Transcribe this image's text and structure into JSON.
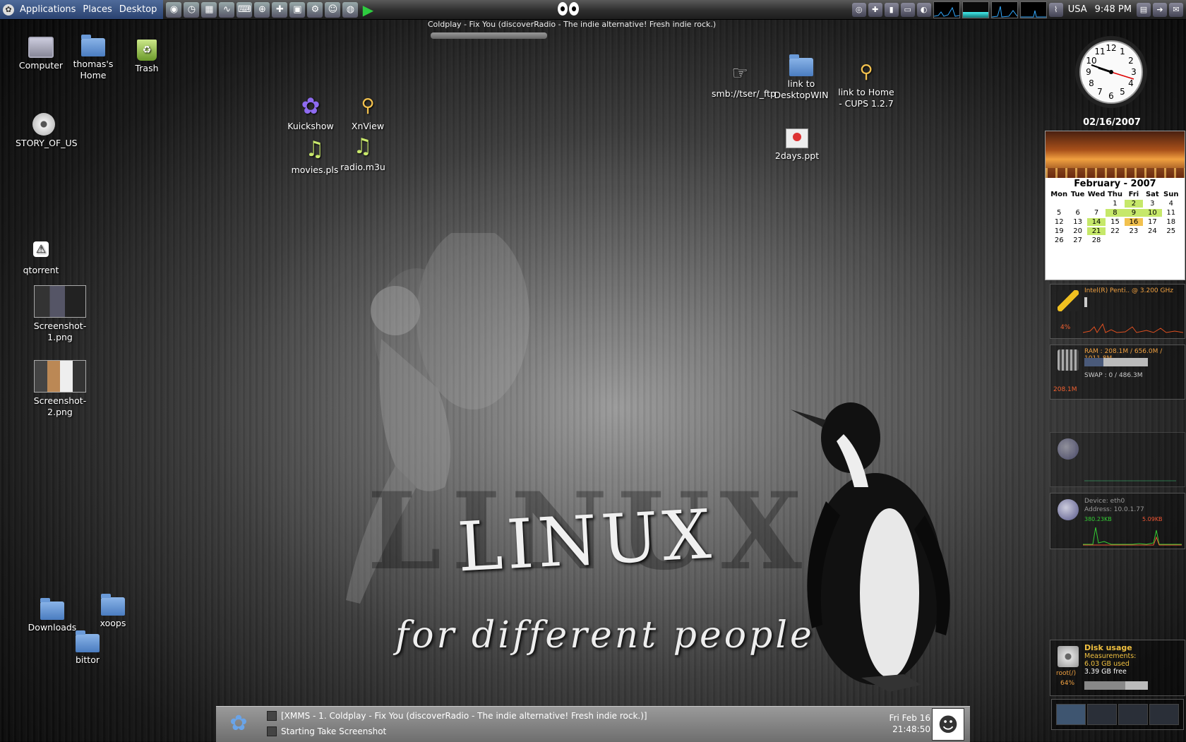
{
  "top_panel": {
    "menus": [
      "Applications",
      "Places",
      "Desktop"
    ],
    "tray_locale": "USA",
    "tray_time": "9:48 PM"
  },
  "xmms": {
    "now_playing": "Coldplay - Fix You (discoverRadio - The indie alternative! Fresh indie rock.)"
  },
  "desktop_icons": {
    "computer": "Computer",
    "home": "thomas's Home",
    "trash": "Trash",
    "story": "STORY_OF_US",
    "qtorrent": "qtorrent",
    "screenshot1": "Screenshot-1.png",
    "screenshot2": "Screenshot-2.png",
    "downloads": "Downloads",
    "xoops": "xoops",
    "bittor": "bittor",
    "kuickshow": "Kuickshow",
    "xnview": "XnView",
    "movies": "movies.pls",
    "radio": "radio.m3u",
    "smb": "smb://tser/_ftp",
    "link_win": "link to DesktopWIN",
    "link_cups": "link to Home - CUPS 1.2.7",
    "ppt": "2days.ppt"
  },
  "wallpaper": {
    "title": "LINUX",
    "shadow": "LINUX",
    "tagline": "for different people"
  },
  "clock": {
    "date": "02/16/2007"
  },
  "calendar": {
    "month": "February - 2007",
    "weekdays": [
      "Mon",
      "Tue",
      "Wed",
      "Thu",
      "Fri",
      "Sat",
      "Sun"
    ],
    "days": [
      "",
      "",
      "",
      "1",
      "2",
      "3",
      "4",
      "5",
      "6",
      "7",
      "8",
      "9",
      "10",
      "11",
      "12",
      "13",
      "14",
      "15",
      "16",
      "17",
      "18",
      "19",
      "20",
      "21",
      "22",
      "23",
      "24",
      "25",
      "26",
      "27",
      "28",
      "",
      "",
      "",
      ""
    ],
    "highlighted": [
      2,
      8,
      9,
      10,
      14,
      21
    ],
    "today": 16
  },
  "monitors": {
    "cpu_label": "Intel(R) Penti.. @ 3.200 GHz",
    "cpu_pct": "4%",
    "ram_label": "RAM : 208.1M / 656.0M / 1011.8M",
    "swap_label": "SWAP : 0 / 486.3M",
    "ram_used": "208.1M",
    "net_device": "Device: eth0",
    "net_address": "Address: 10.0.1.77",
    "net_rate_down": "380.23KB",
    "net_rate_up": "5.09KB",
    "disk_title": "Disk usage",
    "disk_measure": "Measurements:",
    "disk_used": "6.03 GB used",
    "disk_free": "3.39 GB free",
    "disk_root": "root(/)",
    "disk_pct": "64%",
    "disk_fraction": 0.64
  },
  "bottom_panel": {
    "task1": "[XMMS - 1. Coldplay - Fix You (discoverRadio - The indie alternative! Fresh indie rock.)]",
    "task2": "Starting Take Screenshot",
    "date": "Fri Feb 16",
    "time": "21:48:50"
  },
  "colors": {
    "calendar_highlight": "#c6e86a",
    "calendar_today": "#f2c14e",
    "monitor_accent": "#f0a040"
  }
}
